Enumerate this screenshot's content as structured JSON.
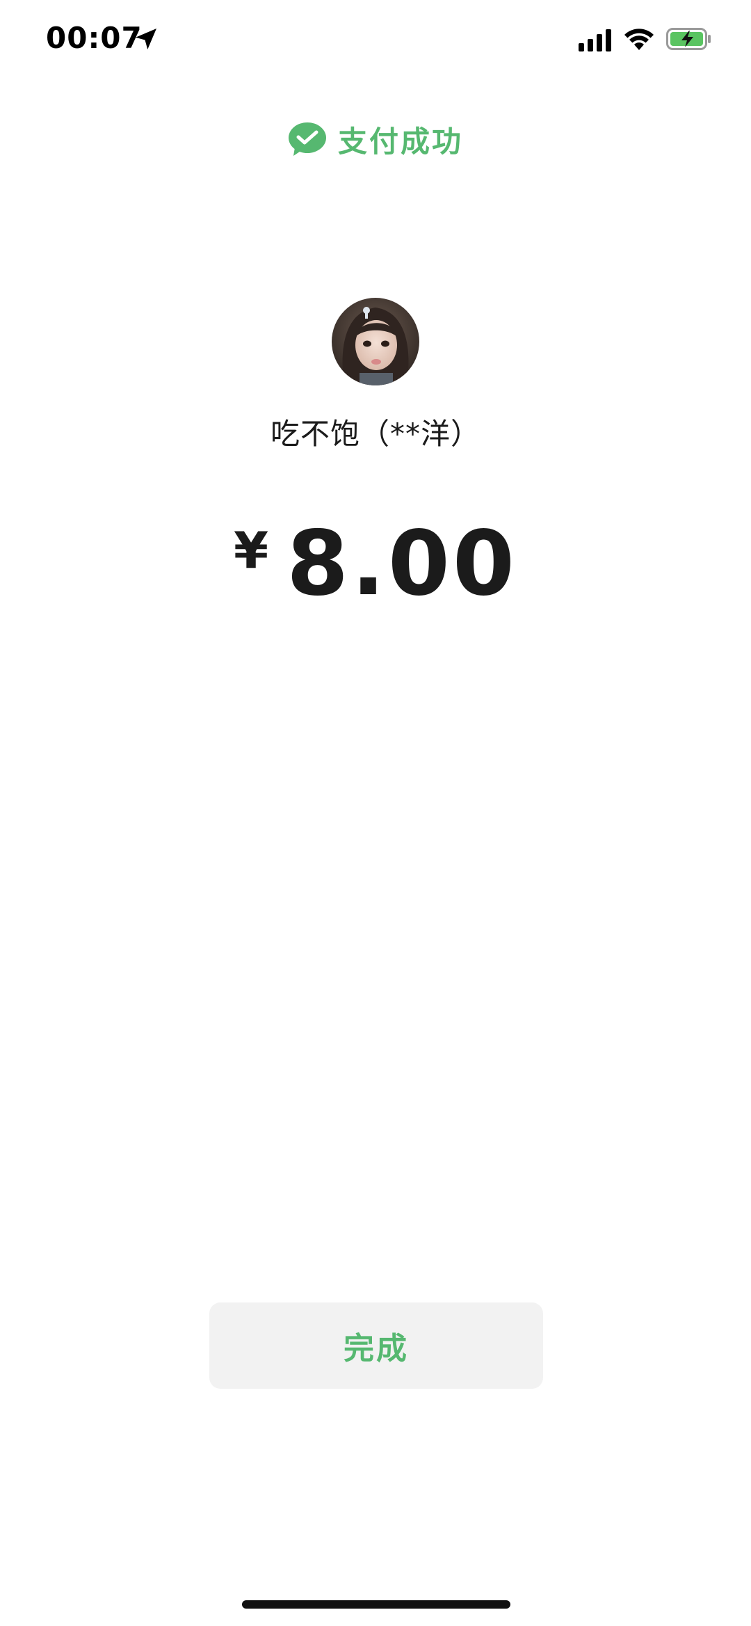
{
  "status_bar": {
    "time": "00:07",
    "icons": [
      "location-arrow-icon",
      "cellular-signal-icon",
      "wifi-icon",
      "battery-charging-icon"
    ],
    "battery_color": "#5ac461"
  },
  "header": {
    "icon": "wechat-pay-icon",
    "title": "支付成功",
    "accent_color": "#56b870"
  },
  "payee": {
    "avatar": "avatar-photo",
    "name": "吃不饱（**洋）"
  },
  "payment": {
    "currency": "¥",
    "amount": "8.00"
  },
  "actions": {
    "done_label": "完成"
  }
}
